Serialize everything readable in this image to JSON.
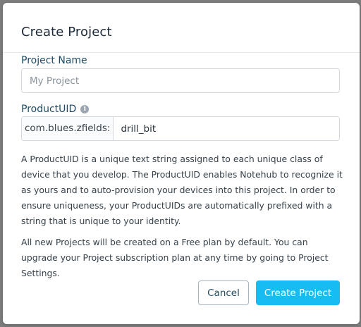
{
  "dialog": {
    "title": "Create Project"
  },
  "project_name": {
    "label": "Project Name",
    "placeholder": "My Project",
    "value": ""
  },
  "product_uid": {
    "label": "ProductUID",
    "info_icon": "info-icon",
    "prefix": "com.blues.zfields:",
    "value": "drill_bit"
  },
  "help_text": [
    "A ProductUID is a unique text string assigned to each unique class of device that you develop. The ProductUID enables Notehub to recognize it as yours and to auto-provision your devices into this project. In order to ensure uniqueness, your ProductUIDs are automatically prefixed with a string that is unique to your identity.",
    "All new Projects will be created on a Free plan by default. You can upgrade your Project subscription plan at any time by going to Project Settings."
  ],
  "buttons": {
    "cancel": "Cancel",
    "create": "Create Project"
  },
  "colors": {
    "primary": "#17bdf2",
    "label": "#1f4a63",
    "overlay": "#7d7d7d"
  }
}
